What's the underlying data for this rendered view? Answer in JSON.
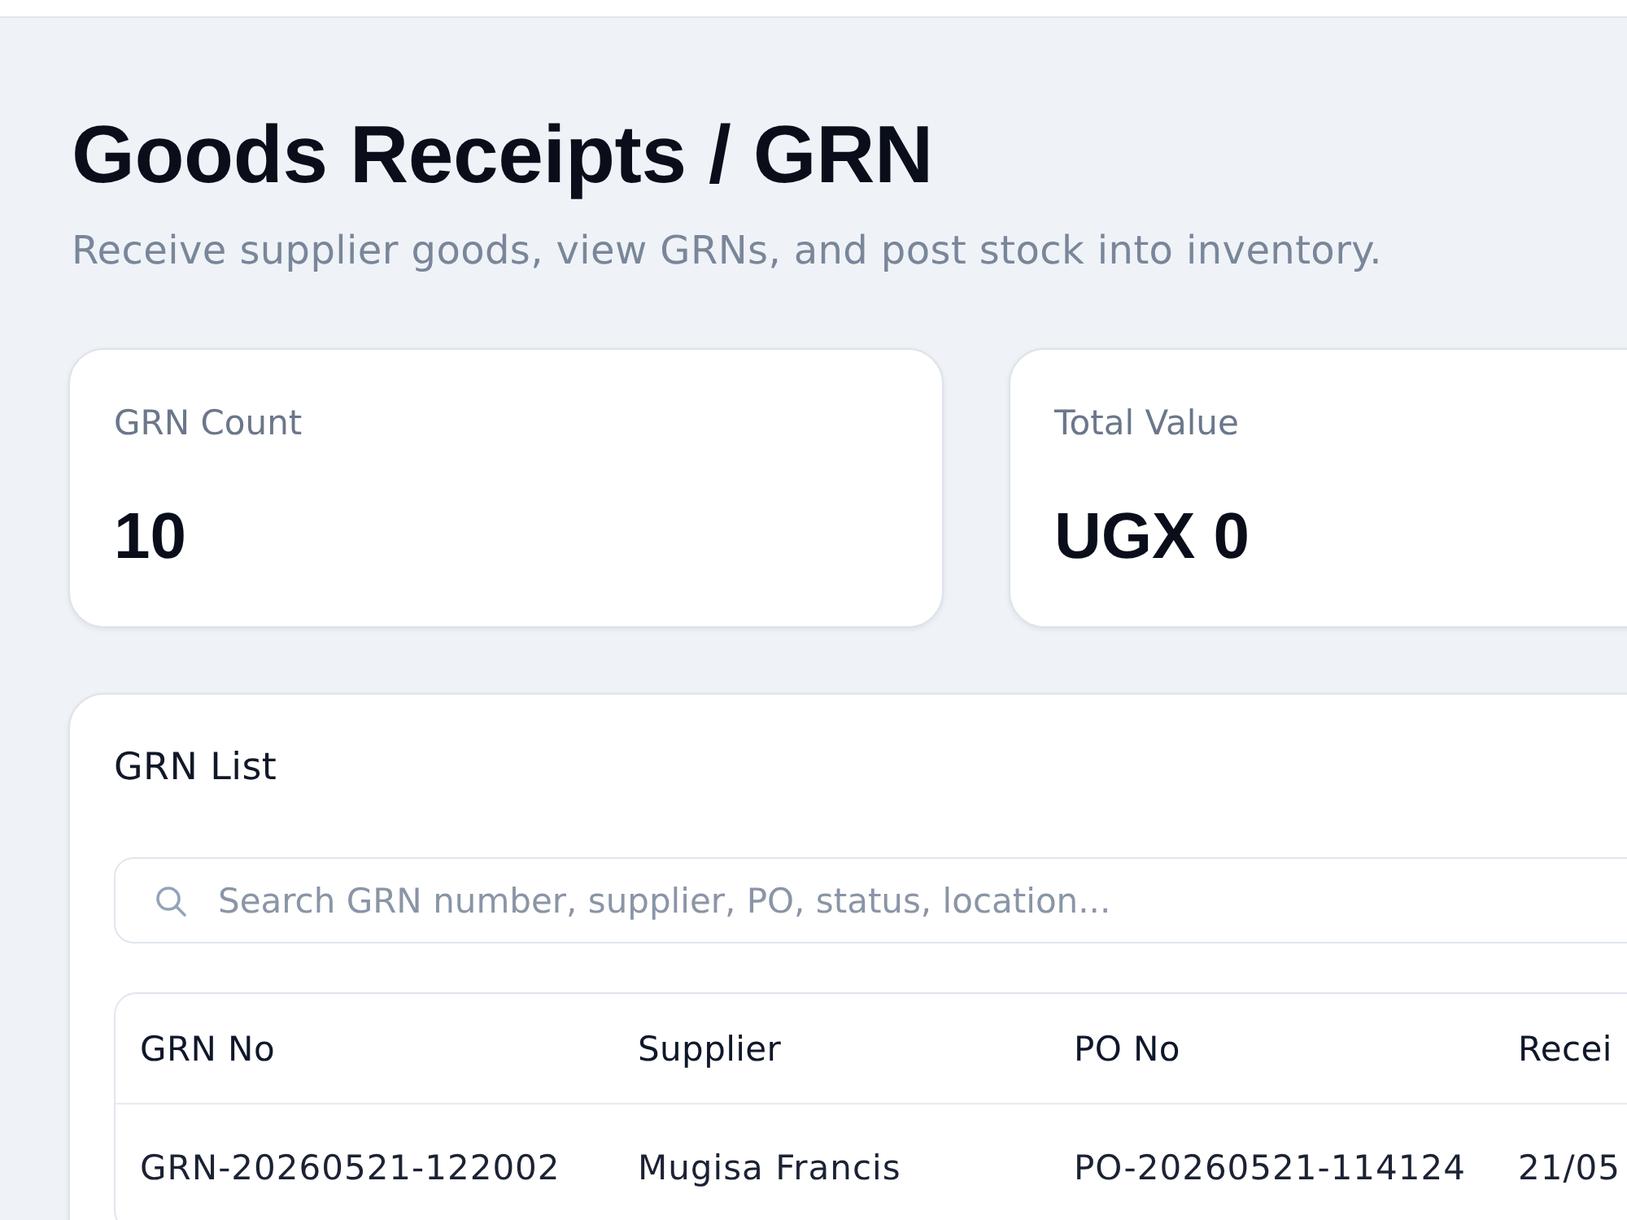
{
  "page": {
    "title": "Goods Receipts / GRN",
    "subtitle": "Receive supplier goods, view GRNs, and post stock into inventory."
  },
  "stats": [
    {
      "label": "GRN Count",
      "value": "10"
    },
    {
      "label": "Total Value",
      "value": "UGX 0"
    }
  ],
  "grn_list": {
    "title": "GRN List",
    "search": {
      "placeholder": "Search GRN number, supplier, PO, status, location..."
    },
    "table": {
      "columns": [
        "GRN No",
        "Supplier",
        "PO No",
        "Recei"
      ],
      "rows": [
        [
          "GRN-20260521-122002",
          "Mugisa Francis",
          "PO-20260521-114124",
          "21/05"
        ]
      ]
    }
  }
}
